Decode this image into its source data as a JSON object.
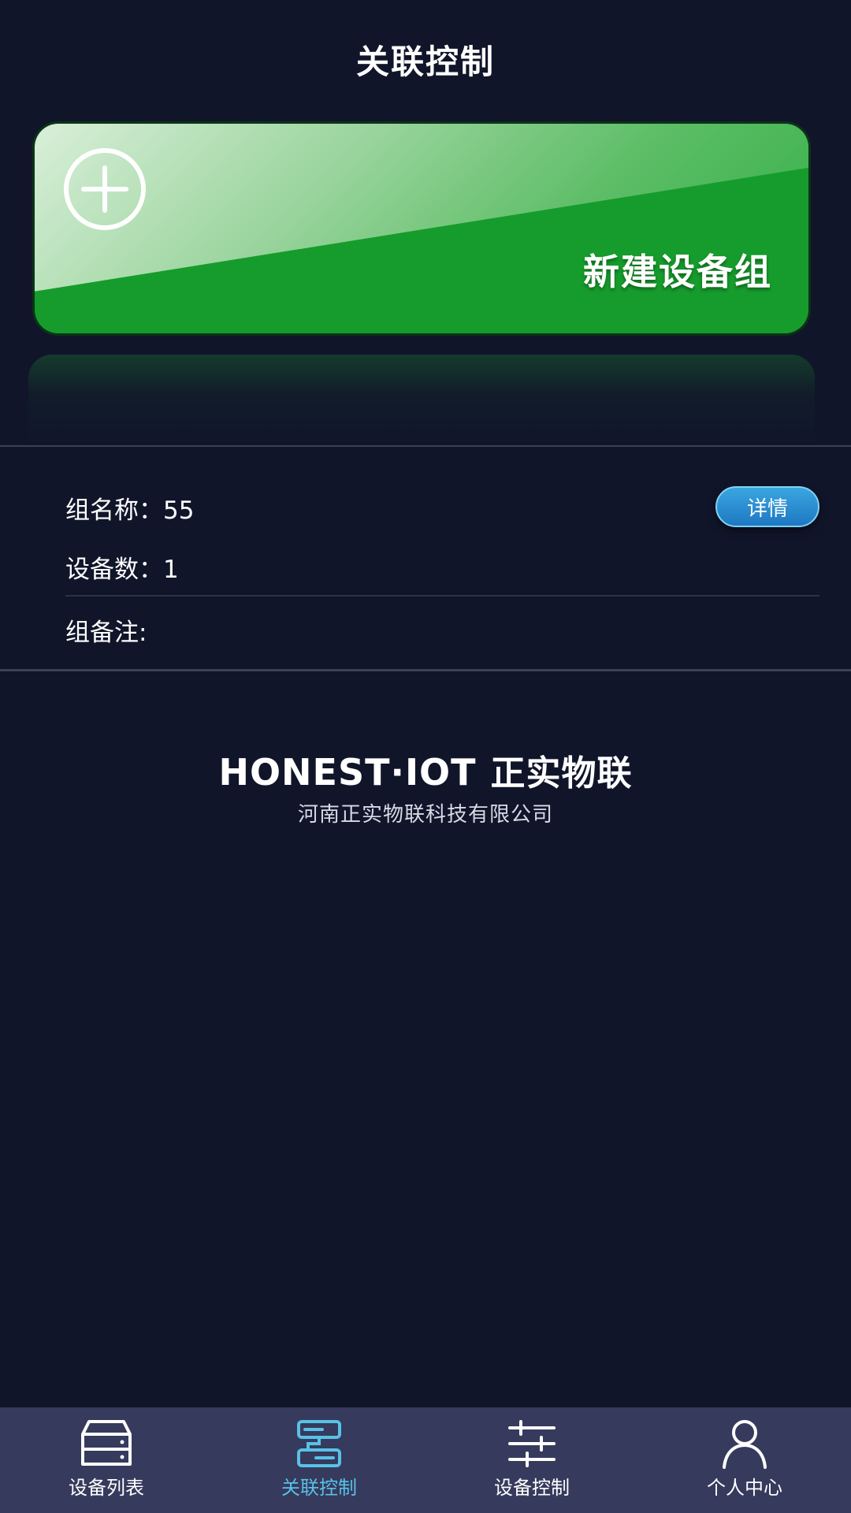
{
  "header": {
    "title": "关联控制"
  },
  "new_group": {
    "label": "新建设备组",
    "icon": "plus-circle-icon"
  },
  "group": {
    "name_label": "组名称：55",
    "count_label": "设备数：1",
    "note_label": "组备注:",
    "detail_button": "详情"
  },
  "brand": {
    "logo_prefix": "H",
    "logo_main": "ONEST·IOT",
    "logo_cn_a": "正",
    "logo_cn_b": "实物联",
    "subtitle": "河南正实物联科技有限公司"
  },
  "tabbar": {
    "items": [
      {
        "label": "设备列表",
        "icon": "device-list-icon",
        "active": false
      },
      {
        "label": "关联控制",
        "icon": "linked-control-icon",
        "active": true
      },
      {
        "label": "设备控制",
        "icon": "sliders-icon",
        "active": false
      },
      {
        "label": "个人中心",
        "icon": "user-icon",
        "active": false
      }
    ]
  },
  "colors": {
    "background": "#11152a",
    "accent": "#58c2e6",
    "green": "#169c2c",
    "tabbar": "#363a5c"
  }
}
